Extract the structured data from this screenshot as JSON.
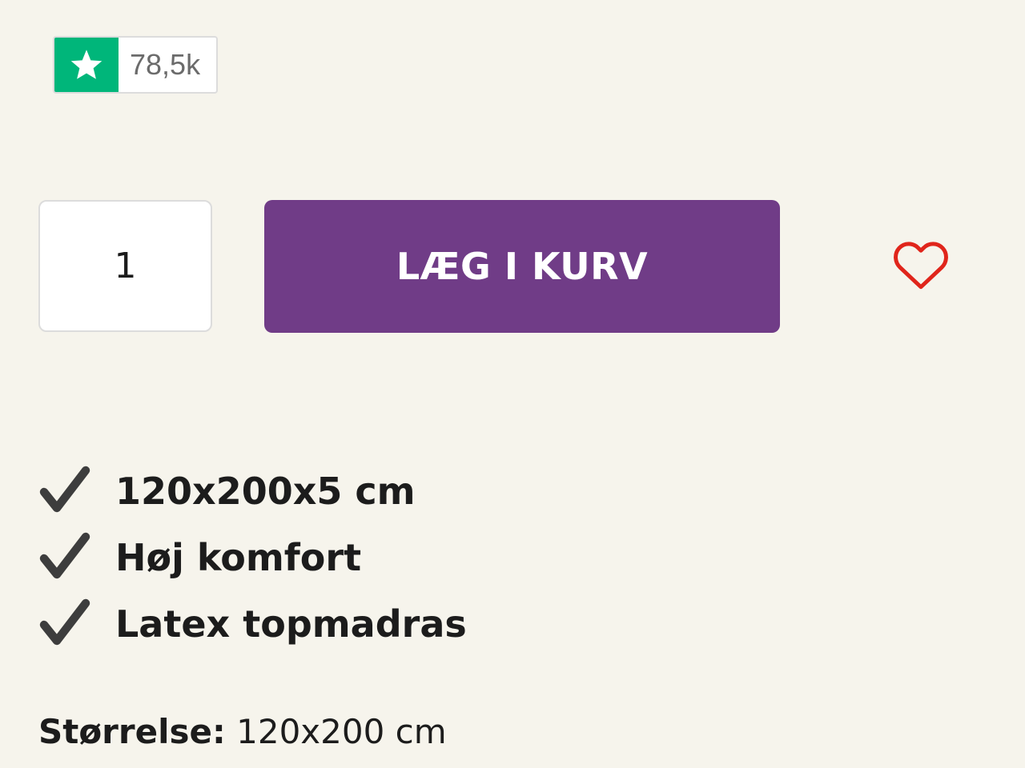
{
  "rating_badge": {
    "icon": "star-icon",
    "count": "78,5k",
    "brand_color": "#00b67a"
  },
  "purchase": {
    "quantity": "1",
    "add_to_cart_label": "LÆG I KURV",
    "button_color": "#703c87",
    "wishlist_icon": "heart-outline-icon",
    "wishlist_color": "#e0251b"
  },
  "features": [
    {
      "icon": "checkmark-icon",
      "text": "120x200x5 cm"
    },
    {
      "icon": "checkmark-icon",
      "text": "Høj komfort"
    },
    {
      "icon": "checkmark-icon",
      "text": "Latex topmadras"
    }
  ],
  "size": {
    "label": "Størrelse:",
    "value": "120x200 cm"
  }
}
